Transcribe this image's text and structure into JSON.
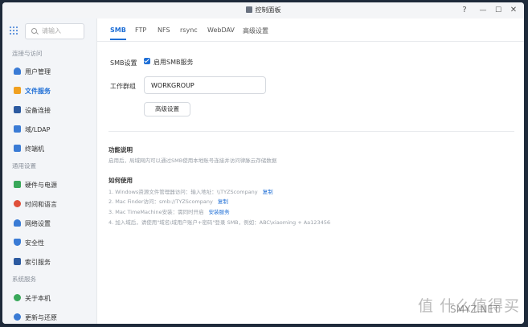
{
  "window": {
    "title": "控制面板",
    "help": "?",
    "minimize": "—",
    "maximize": "☐",
    "close": "✕"
  },
  "sidebar": {
    "search_placeholder": "请输入",
    "sections": [
      {
        "label": "连接与访问"
      },
      {
        "label": "通用设置"
      },
      {
        "label": "系统服务"
      }
    ],
    "items": [
      {
        "label": "用户管理",
        "icon": "user-icon",
        "color": "#3a7bd5"
      },
      {
        "label": "文件服务",
        "icon": "file-service-icon",
        "color": "#f0a020",
        "active": true
      },
      {
        "label": "设备连接",
        "icon": "device-icon",
        "color": "#2c5aa0"
      },
      {
        "label": "域/LDAP",
        "icon": "ldap-icon",
        "color": "#3a7bd5"
      },
      {
        "label": "终端机",
        "icon": "terminal-icon",
        "color": "#3a7bd5"
      },
      {
        "label": "硬件与电源",
        "icon": "hardware-icon",
        "color": "#39a85a"
      },
      {
        "label": "时间和语言",
        "icon": "clock-icon",
        "color": "#e0503a"
      },
      {
        "label": "网络设置",
        "icon": "network-icon",
        "color": "#3a7bd5"
      },
      {
        "label": "安全性",
        "icon": "shield-icon",
        "color": "#3a7bd5"
      },
      {
        "label": "索引服务",
        "icon": "index-icon",
        "color": "#2c5aa0"
      },
      {
        "label": "关于本机",
        "icon": "info-icon",
        "color": "#39a85a"
      },
      {
        "label": "更新与还原",
        "icon": "update-icon",
        "color": "#3a7bd5"
      }
    ]
  },
  "tabs": [
    {
      "label": "SMB",
      "active": true
    },
    {
      "label": "FTP"
    },
    {
      "label": "NFS"
    },
    {
      "label": "rsync"
    },
    {
      "label": "WebDAV"
    },
    {
      "label": "高级设置"
    }
  ],
  "smb": {
    "settings_label": "SMB设置",
    "enable_label": "启用SMB服务",
    "enabled": true,
    "workgroup_label": "工作群组",
    "workgroup_value": "WORKGROUP",
    "advanced_button": "高级设置"
  },
  "info": {
    "feature_heading": "功能说明",
    "feature_desc": "启用后，局域网内可以通过SMB使用本地账号连接并访问律脉云存储数据",
    "usage_heading": "如何使用",
    "usage": [
      {
        "text": "1. Windows资源文件管理器访问：输入地址：\\\\TYZScompany",
        "link": "复制"
      },
      {
        "text": "2. Mac Finder访问：smb://TYZScompany",
        "link": "复制"
      },
      {
        "text": "3. Mac TimeMachine安装：需同时开启",
        "link": "安装服务"
      },
      {
        "text": "4. 加入域后，请使用\"域名\\域用户账户+密码\"登录 SMB，例如：ABC\\xiaoming + Aa123456",
        "link": ""
      }
    ]
  },
  "watermark": {
    "text": "值 什么值得买",
    "sub": "SMYZ.NET"
  }
}
